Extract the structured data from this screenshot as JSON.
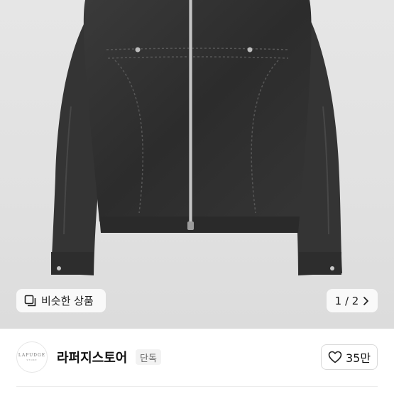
{
  "product_image": {
    "alt": "",
    "similar_button": {
      "label": "비슷한 상품",
      "icon": "similar-products-icon"
    },
    "pager": {
      "text": "1 / 2",
      "icon": "chevron-right-icon"
    }
  },
  "store": {
    "logo": {
      "name": "LAPUDGE",
      "sub": "STORE"
    },
    "name": "라퍼지스토어",
    "badge": "단독",
    "like": {
      "count": "35만",
      "icon": "heart-outline-icon"
    }
  }
}
